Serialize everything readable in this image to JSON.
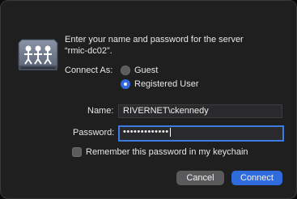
{
  "prompt": {
    "line1": "Enter your name and password for the server",
    "line2": "“rmic-dc02”."
  },
  "connect_as": {
    "label": "Connect As:",
    "options": [
      {
        "label": "Guest",
        "selected": false
      },
      {
        "label": "Registered User",
        "selected": true
      }
    ]
  },
  "name": {
    "label": "Name:",
    "value": "RIVERNET\\ckennedy"
  },
  "password": {
    "label": "Password:",
    "masked_value": "•••••••••••••"
  },
  "remember": {
    "label": "Remember this password in my keychain",
    "checked": false
  },
  "buttons": {
    "cancel": "Cancel",
    "connect": "Connect"
  },
  "colors": {
    "accent": "#2f6bdc",
    "background": "#1f1f20"
  },
  "icons": {
    "server": "shared-server-icon"
  }
}
